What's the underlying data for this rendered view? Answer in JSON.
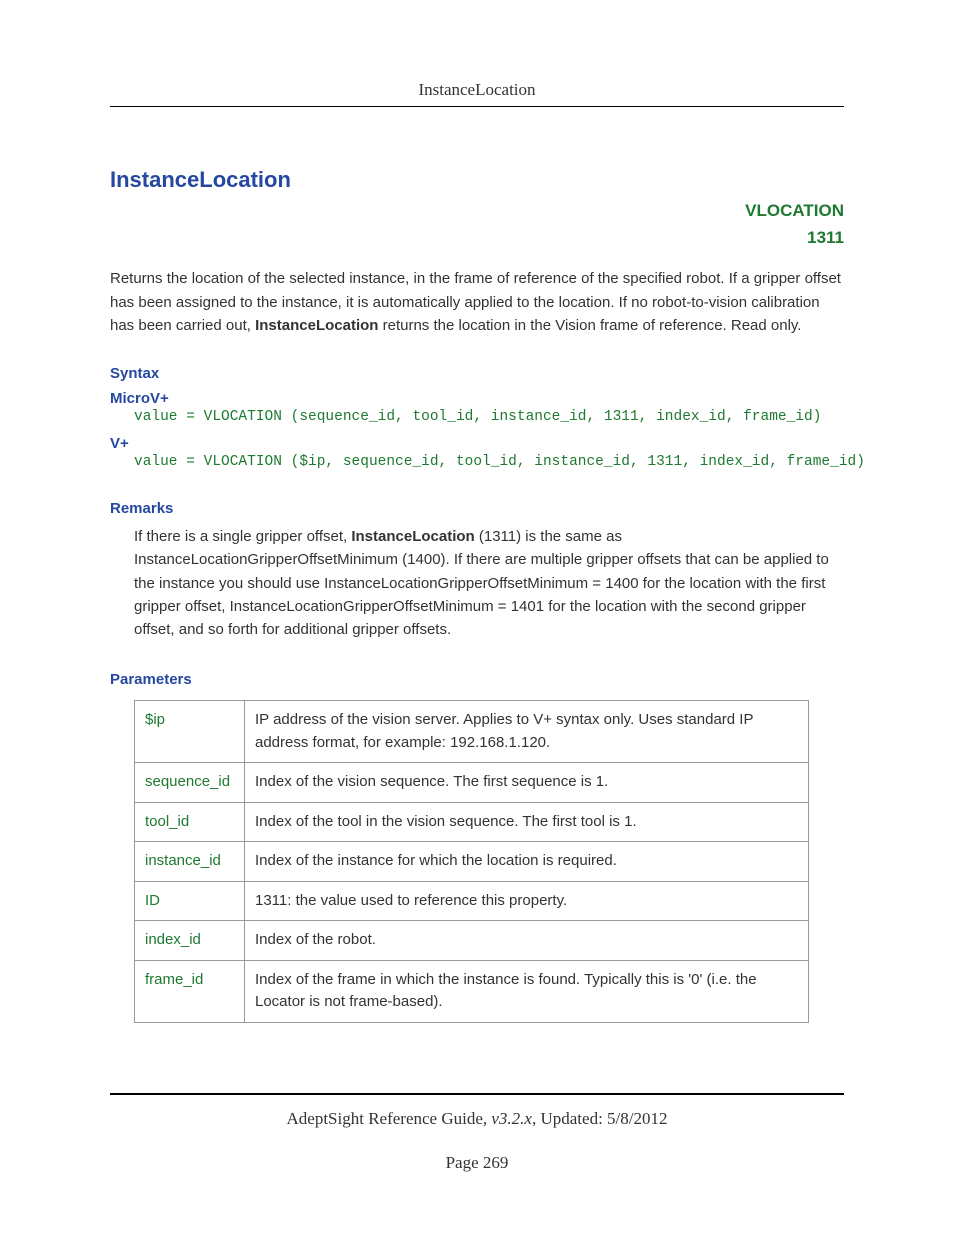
{
  "header": {
    "title": "InstanceLocation"
  },
  "title": "InstanceLocation",
  "tag": {
    "name": "VLOCATION",
    "code": "1311"
  },
  "intro": {
    "pre": "Returns the location of the selected instance, in the frame of reference of the specified robot. If a gripper offset has been assigned to the instance, it is automatically applied to the location. If no robot-to-vision calibration has been carried out, ",
    "bold": "InstanceLocation",
    "post": " returns the location in the Vision frame of reference. Read only."
  },
  "syntax": {
    "label": "Syntax",
    "microv_label": "MicroV+",
    "microv_code": "value = VLOCATION (sequence_id, tool_id, instance_id, 1311, index_id, frame_id)",
    "vplus_label": "V+",
    "vplus_code": "value = VLOCATION ($ip, sequence_id, tool_id, instance_id, 1311, index_id, frame_id)"
  },
  "remarks": {
    "label": "Remarks",
    "pre": "If there is a single gripper offset, ",
    "bold": "InstanceLocation",
    "post": " (1311) is the same as InstanceLocationGripperOffsetMinimum (1400). If there are multiple gripper offsets that can be applied to the instance you should use InstanceLocationGripperOffsetMinimum = 1400 for the location with the first gripper offset, InstanceLocationGripperOffsetMinimum = 1401 for the location with the second gripper offset, and so forth for additional gripper offsets."
  },
  "parameters": {
    "label": "Parameters",
    "rows": [
      {
        "name": "$ip",
        "desc": "IP address of the vision server. Applies to V+ syntax only. Uses standard IP address format, for example: 192.168.1.120."
      },
      {
        "name": "sequence_id",
        "desc": "Index of the vision sequence. The first sequence is 1."
      },
      {
        "name": "tool_id",
        "desc": "Index of the tool in the vision sequence. The first tool is 1."
      },
      {
        "name": "instance_id",
        "desc": "Index of the instance for which the location is required."
      },
      {
        "name": "ID",
        "desc": "1311: the value used to reference this property."
      },
      {
        "name": "index_id",
        "desc": "Index of the robot."
      },
      {
        "name": "frame_id",
        "desc": "Index of the frame in which the instance is found. Typically this is '0' (i.e. the Locator is not frame-based)."
      }
    ]
  },
  "footer": {
    "doc": "AdeptSight Reference Guide",
    "version": ", v3.2.x",
    "updated": ", Updated: 5/8/2012",
    "page": "Page 269"
  }
}
